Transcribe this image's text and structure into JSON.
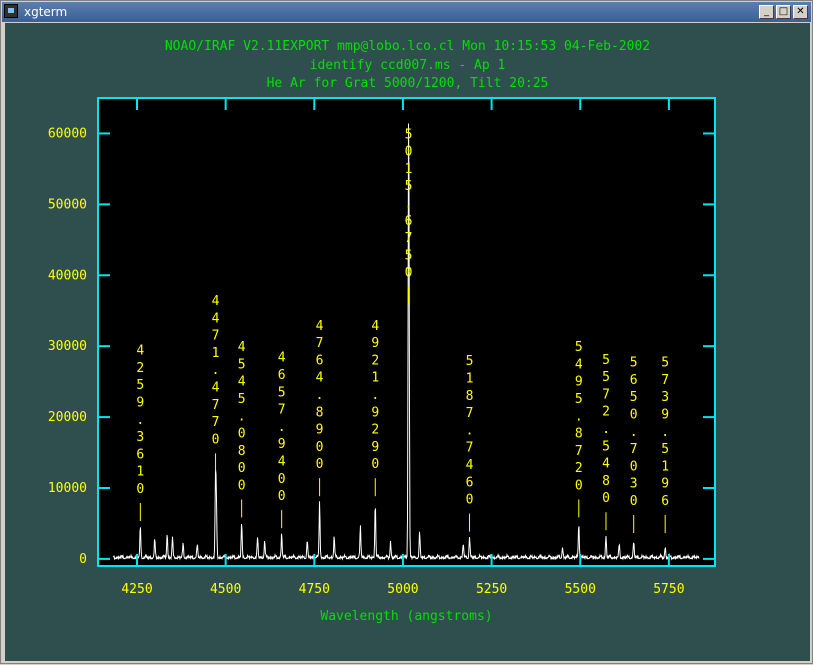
{
  "window": {
    "title": "xgterm",
    "buttons": {
      "minimize": "_",
      "maximize": "□",
      "close": "✕"
    }
  },
  "header": {
    "line1": "NOAO/IRAF V2.11EXPORT mmp@lobo.lco.cl Mon 10:15:53 04-Feb-2002",
    "line2": "identify ccd007.ms - Ap 1",
    "line3": "He Ar for Grat 5000/1200, Tilt 20:25"
  },
  "colors": {
    "background": "#2f4f4f",
    "axis": "#00e5ee",
    "labels": "#ffff00",
    "header": "#00e000",
    "spectrum": "#ffffff",
    "plot_bg": "#000000"
  },
  "chart_data": {
    "type": "line",
    "xlabel": "Wavelength (angstroms)",
    "ylabel": "",
    "xlim": [
      4140,
      5880
    ],
    "ylim": [
      -1000,
      65000
    ],
    "x_ticks": [
      4250,
      4500,
      4750,
      5000,
      5250,
      5500,
      5750
    ],
    "x_tick_labels": [
      "4250",
      "4500",
      "4750",
      "5000",
      "5250",
      "5500",
      "5750"
    ],
    "y_ticks": [
      0,
      10000,
      20000,
      30000,
      40000,
      50000,
      60000
    ],
    "y_tick_labels": [
      "0",
      "10000",
      "20000",
      "30000",
      "40000",
      "50000",
      "60000"
    ],
    "identified_lines": [
      {
        "label": "4259.3610",
        "x": 4259.361,
        "peak": 4500
      },
      {
        "label": "4471.4770",
        "x": 4471.477,
        "peak": 11500
      },
      {
        "label": "4545.0800",
        "x": 4545.08,
        "peak": 5000
      },
      {
        "label": "4657.9400",
        "x": 4657.94,
        "peak": 3500
      },
      {
        "label": "4764.8900",
        "x": 4764.89,
        "peak": 8000
      },
      {
        "label": "4921.9290",
        "x": 4921.929,
        "peak": 8000
      },
      {
        "label": "5015.6750",
        "x": 5015.675,
        "peak": 35000
      },
      {
        "label": "5187.7460",
        "x": 5187.746,
        "peak": 3000
      },
      {
        "label": "5495.8720",
        "x": 5495.872,
        "peak": 5000
      },
      {
        "label": "5572.5480",
        "x": 5572.548,
        "peak": 3200
      },
      {
        "label": "5650.7030",
        "x": 5650.703,
        "peak": 2200
      },
      {
        "label": "5739.5196",
        "x": 5739.5196,
        "peak": 1500
      }
    ],
    "extra_lines": [
      {
        "x": 4300,
        "peak": 2500
      },
      {
        "x": 4335,
        "peak": 3500
      },
      {
        "x": 4350,
        "peak": 2800
      },
      {
        "x": 4380,
        "peak": 2000
      },
      {
        "x": 4420,
        "peak": 1800
      },
      {
        "x": 4474,
        "peak": 7000
      },
      {
        "x": 4590,
        "peak": 2800
      },
      {
        "x": 4610,
        "peak": 2400
      },
      {
        "x": 4730,
        "peak": 2500
      },
      {
        "x": 4806,
        "peak": 3000
      },
      {
        "x": 4880,
        "peak": 4500
      },
      {
        "x": 4965,
        "peak": 2300
      },
      {
        "x": 5017,
        "peak": 31000
      },
      {
        "x": 5015,
        "peak": 9500
      },
      {
        "x": 5047,
        "peak": 3500
      },
      {
        "x": 5170,
        "peak": 2000
      },
      {
        "x": 5450,
        "peak": 1500
      },
      {
        "x": 5610,
        "peak": 1800
      }
    ]
  }
}
